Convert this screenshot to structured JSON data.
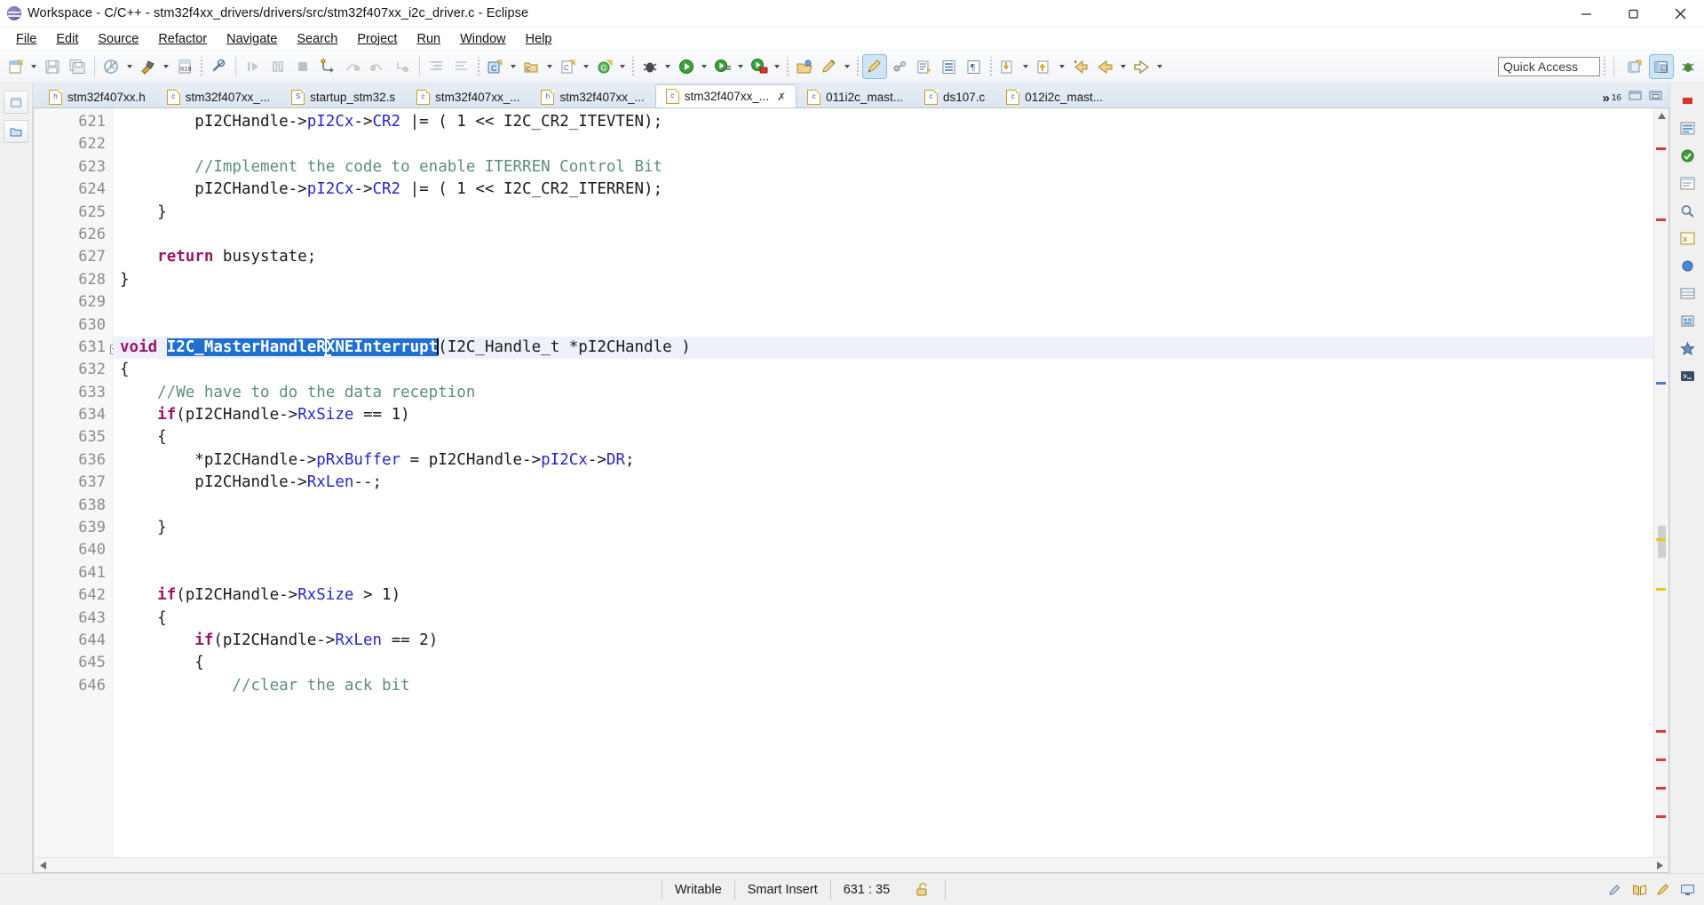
{
  "window": {
    "title": "Workspace - C/C++ - stm32f4xx_drivers/drivers/src/stm32f407xx_i2c_driver.c - Eclipse",
    "app_icon": "eclipse-icon",
    "minimize": "minimize-icon",
    "maximize": "maximize-icon",
    "close": "close-icon"
  },
  "menubar": {
    "items": [
      {
        "label": "File",
        "mnemonic": "F"
      },
      {
        "label": "Edit",
        "mnemonic": "E"
      },
      {
        "label": "Source",
        "mnemonic": "S"
      },
      {
        "label": "Refactor",
        "mnemonic": "R"
      },
      {
        "label": "Navigate",
        "mnemonic": "N"
      },
      {
        "label": "Search",
        "mnemonic": "S"
      },
      {
        "label": "Project",
        "mnemonic": "P"
      },
      {
        "label": "Run",
        "mnemonic": "R"
      },
      {
        "label": "Window",
        "mnemonic": "W"
      },
      {
        "label": "Help",
        "mnemonic": "H"
      }
    ]
  },
  "toolbar": {
    "quick_access_placeholder": "Quick Access",
    "quick_access_value": "",
    "buttons": [
      "new-file-icon",
      "save-icon",
      "save-all-icon",
      "build-disabled-icon",
      "build-hammer-icon",
      "binary-010-icon",
      "no-build-icon",
      "resume-icon",
      "suspend-icon",
      "terminate-icon",
      "step-into-icon",
      "step-over-icon",
      "step-return-icon",
      "drop-to-frame-icon",
      "indent-icon",
      "outdent-icon",
      "new-c-project-icon",
      "new-cpp-folder-icon",
      "new-c-file-icon",
      "new-class-icon",
      "debug-bug-icon",
      "run-icon",
      "run-external-tools-icon",
      "run-last-icon",
      "open-type-icon",
      "pencil-edit-icon",
      "toggle-mark-occurrences-icon",
      "link-icon",
      "show-source-quick-icon",
      "show-outline-icon",
      "show-whitespace-icon",
      "next-annotation-icon",
      "previous-annotation-icon",
      "last-edit-location-icon",
      "back-icon",
      "forward-icon"
    ],
    "perspective": [
      "open-perspective-icon",
      "cpp-perspective-icon",
      "debug-perspective-icon"
    ]
  },
  "editor_tabs": {
    "items": [
      {
        "label": "stm32f407xx.h",
        "kind": "h",
        "selected": false,
        "dirty": false
      },
      {
        "label": "stm32f407xx_...",
        "kind": "c",
        "selected": false,
        "dirty": false
      },
      {
        "label": "startup_stm32.s",
        "kind": "S",
        "selected": false,
        "dirty": false
      },
      {
        "label": "stm32f407xx_...",
        "kind": "c",
        "selected": false,
        "dirty": false
      },
      {
        "label": "stm32f407xx_...",
        "kind": "h",
        "selected": false,
        "dirty": false
      },
      {
        "label": "stm32f407xx_...",
        "kind": "c",
        "selected": true,
        "dirty": false
      },
      {
        "label": "011i2c_mast...",
        "kind": "c",
        "selected": false,
        "dirty": false
      },
      {
        "label": "ds107.c",
        "kind": "c",
        "selected": false,
        "dirty": false
      },
      {
        "label": "012i2c_mast...",
        "kind": "c",
        "selected": false,
        "dirty": false
      }
    ],
    "overflow_label": "»",
    "overflow_count": "16",
    "close_glyph": "✗",
    "minimize_icon": "minimize-view-icon",
    "maximize_icon": "maximize-view-icon"
  },
  "editor": {
    "first_line": 621,
    "cursor_position": "631 : 35",
    "selection_text": "I2C_MasterHandleRXNEInterrupt",
    "lines": [
      {
        "n": 621,
        "fold": false,
        "current": false,
        "tokens": [
          {
            "t": "        pI2CHandle->",
            "c": "plain"
          },
          {
            "t": "pI2Cx",
            "c": "fld"
          },
          {
            "t": "->",
            "c": "plain"
          },
          {
            "t": "CR2",
            "c": "fld"
          },
          {
            "t": " |= ( 1 << I2C_CR2_ITEVTEN);",
            "c": "plain"
          }
        ]
      },
      {
        "n": 622,
        "fold": false,
        "current": false,
        "tokens": []
      },
      {
        "n": 623,
        "fold": false,
        "current": false,
        "tokens": [
          {
            "t": "        //Implement the code to enable ITERREN Control Bit",
            "c": "cm"
          }
        ]
      },
      {
        "n": 624,
        "fold": false,
        "current": false,
        "tokens": [
          {
            "t": "        pI2CHandle->",
            "c": "plain"
          },
          {
            "t": "pI2Cx",
            "c": "fld"
          },
          {
            "t": "->",
            "c": "plain"
          },
          {
            "t": "CR2",
            "c": "fld"
          },
          {
            "t": " |= ( 1 << I2C_CR2_ITERREN);",
            "c": "plain"
          }
        ]
      },
      {
        "n": 625,
        "fold": false,
        "current": false,
        "tokens": [
          {
            "t": "    }",
            "c": "plain"
          }
        ]
      },
      {
        "n": 626,
        "fold": false,
        "current": false,
        "tokens": []
      },
      {
        "n": 627,
        "fold": false,
        "current": false,
        "tokens": [
          {
            "t": "    ",
            "c": "plain"
          },
          {
            "t": "return",
            "c": "kw"
          },
          {
            "t": " busystate;",
            "c": "plain"
          }
        ]
      },
      {
        "n": 628,
        "fold": false,
        "current": false,
        "tokens": [
          {
            "t": "}",
            "c": "plain"
          }
        ]
      },
      {
        "n": 629,
        "fold": false,
        "current": false,
        "tokens": []
      },
      {
        "n": 630,
        "fold": false,
        "current": false,
        "tokens": []
      },
      {
        "n": 631,
        "fold": true,
        "current": true,
        "tokens": [
          {
            "t": "void",
            "c": "kw"
          },
          {
            "t": " ",
            "c": "plain"
          },
          {
            "t": "I2C_MasterHandleR",
            "c": "sel"
          },
          {
            "t": "",
            "c": "icaret"
          },
          {
            "t": "XNEInterrupt",
            "c": "sel"
          },
          {
            "t": "",
            "c": "caret"
          },
          {
            "t": "(I2C_Handle_t *pI2CHandle )",
            "c": "plain"
          }
        ]
      },
      {
        "n": 632,
        "fold": false,
        "current": false,
        "tokens": [
          {
            "t": "{",
            "c": "plain"
          }
        ]
      },
      {
        "n": 633,
        "fold": false,
        "current": false,
        "tokens": [
          {
            "t": "    //We have to do the data reception",
            "c": "cm"
          }
        ]
      },
      {
        "n": 634,
        "fold": false,
        "current": false,
        "tokens": [
          {
            "t": "    ",
            "c": "plain"
          },
          {
            "t": "if",
            "c": "kw"
          },
          {
            "t": "(pI2CHandle->",
            "c": "plain"
          },
          {
            "t": "RxSize",
            "c": "fld"
          },
          {
            "t": " == 1)",
            "c": "plain"
          }
        ]
      },
      {
        "n": 635,
        "fold": false,
        "current": false,
        "tokens": [
          {
            "t": "    {",
            "c": "plain"
          }
        ]
      },
      {
        "n": 636,
        "fold": false,
        "current": false,
        "tokens": [
          {
            "t": "        *pI2CHandle->",
            "c": "plain"
          },
          {
            "t": "pRxBuffer",
            "c": "fld"
          },
          {
            "t": " = pI2CHandle->",
            "c": "plain"
          },
          {
            "t": "pI2Cx",
            "c": "fld"
          },
          {
            "t": "->",
            "c": "plain"
          },
          {
            "t": "DR",
            "c": "fld"
          },
          {
            "t": ";",
            "c": "plain"
          }
        ]
      },
      {
        "n": 637,
        "fold": false,
        "current": false,
        "tokens": [
          {
            "t": "        pI2CHandle->",
            "c": "plain"
          },
          {
            "t": "RxLen",
            "c": "fld"
          },
          {
            "t": "--;",
            "c": "plain"
          }
        ]
      },
      {
        "n": 638,
        "fold": false,
        "current": false,
        "tokens": []
      },
      {
        "n": 639,
        "fold": false,
        "current": false,
        "tokens": [
          {
            "t": "    }",
            "c": "plain"
          }
        ]
      },
      {
        "n": 640,
        "fold": false,
        "current": false,
        "tokens": []
      },
      {
        "n": 641,
        "fold": false,
        "current": false,
        "tokens": []
      },
      {
        "n": 642,
        "fold": false,
        "current": false,
        "tokens": [
          {
            "t": "    ",
            "c": "plain"
          },
          {
            "t": "if",
            "c": "kw"
          },
          {
            "t": "(pI2CHandle->",
            "c": "plain"
          },
          {
            "t": "RxSize",
            "c": "fld"
          },
          {
            "t": " > 1)",
            "c": "plain"
          }
        ]
      },
      {
        "n": 643,
        "fold": false,
        "current": false,
        "tokens": [
          {
            "t": "    {",
            "c": "plain"
          }
        ]
      },
      {
        "n": 644,
        "fold": false,
        "current": false,
        "tokens": [
          {
            "t": "        ",
            "c": "plain"
          },
          {
            "t": "if",
            "c": "kw"
          },
          {
            "t": "(pI2CHandle->",
            "c": "plain"
          },
          {
            "t": "RxLen",
            "c": "fld"
          },
          {
            "t": " == 2)",
            "c": "plain"
          }
        ]
      },
      {
        "n": 645,
        "fold": false,
        "current": false,
        "tokens": [
          {
            "t": "        {",
            "c": "plain"
          }
        ]
      },
      {
        "n": 646,
        "fold": false,
        "current": false,
        "tokens": [
          {
            "t": "            //clear the ack bit",
            "c": "cm"
          }
        ]
      }
    ],
    "overview_markers": [
      {
        "top": 0.03,
        "color": "#d43f3a"
      },
      {
        "top": 0.13,
        "color": "#d43f3a"
      },
      {
        "top": 0.36,
        "color": "#3f7fd4"
      },
      {
        "top": 0.58,
        "color": "#f0c808"
      },
      {
        "top": 0.65,
        "color": "#f0c808"
      },
      {
        "top": 0.85,
        "color": "#d43f3a"
      },
      {
        "top": 0.89,
        "color": "#d43f3a"
      },
      {
        "top": 0.93,
        "color": "#d43f3a"
      },
      {
        "top": 0.97,
        "color": "#d43f3a"
      }
    ]
  },
  "statusbar": {
    "writable": "Writable",
    "insert_mode": "Smart Insert",
    "position": "631 : 35",
    "lock_icon": "unlock-icon",
    "right_icons": [
      "pencil-status-icon",
      "book-icon",
      "brush-icon",
      "monitor-icon"
    ]
  },
  "colors": {
    "keyword": "#9b1667",
    "comment": "#5f8f77",
    "field": "#2727c7",
    "selection_bg": "#1f6fd0",
    "current_line_bg": "#eef0fa",
    "tab_selected_bg": "#ffffff",
    "toolbar_bg": "#f2f4f7"
  }
}
